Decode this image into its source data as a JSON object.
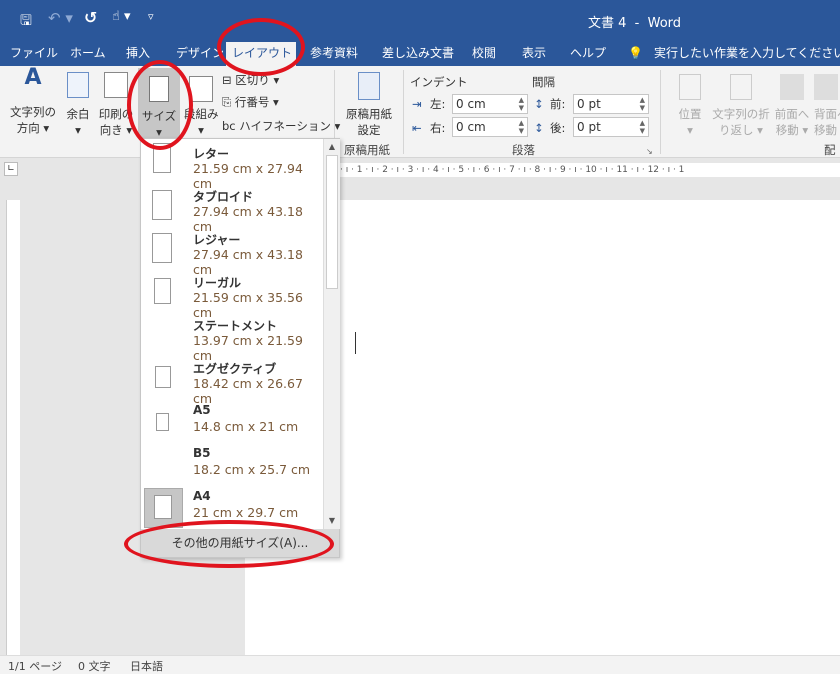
{
  "title": "文書 4  -  Word",
  "qat": [
    "save-icon",
    "undo-icon",
    "redo-icon",
    "touch-mode-icon",
    "customize-icon"
  ],
  "tabs": [
    "ファイル",
    "ホーム",
    "挿入",
    "デザイン",
    "レイアウト",
    "参考資料",
    "差し込み文書",
    "校閲",
    "表示",
    "ヘルプ"
  ],
  "active_tab": "レイアウト",
  "tell_me": "実行したい作業を入力してください",
  "ribbon": {
    "text_direction": [
      "文字列の",
      "方向 ▾"
    ],
    "margins": [
      "余白",
      "▾"
    ],
    "orientation": [
      "印刷の",
      "向き ▾"
    ],
    "size": [
      "サイズ",
      "▾"
    ],
    "columns": [
      "段組み",
      "▾"
    ],
    "breaks": "区切り ▾",
    "line_numbers": "行番号 ▾",
    "hyphenation": "ハイフネーション ▾",
    "genko": [
      "原稿用紙",
      "設定"
    ],
    "genko_group": "原稿用紙",
    "indent_label": "インデント",
    "spacing_label": "間隔",
    "left_label": "左:",
    "left_value": "0 cm",
    "right_label": "右:",
    "right_value": "0 cm",
    "before_label": "前:",
    "before_value": "0 pt",
    "after_label": "後:",
    "after_value": "0 pt",
    "paragraph_group": "段落",
    "position": [
      "位置",
      "▾"
    ],
    "wrap": [
      "文字列の折",
      "り返し ▾"
    ],
    "forward": [
      "前面へ",
      "移動 ▾"
    ],
    "backward": [
      "背面へ",
      "移動 ▾"
    ],
    "arrange_group": "配置"
  },
  "ruler": "· ı · 1 · ı · 2 · ı · 3 · ı · 4 · ı · 5 · ı · 6 · ı · 7 · ı · 8 · ı · 9 · ı · 10 · ı · 11 · ı · 12 · ı · 1",
  "sizes": [
    {
      "name": "レター",
      "size": "21.59 cm x 27.94 cm"
    },
    {
      "name": "タブロイド",
      "size": "27.94 cm x 43.18 cm"
    },
    {
      "name": "レジャー",
      "size": "27.94 cm x 43.18 cm"
    },
    {
      "name": "リーガル",
      "size": "21.59 cm x 35.56 cm"
    },
    {
      "name": "ステートメント",
      "size": "13.97 cm x 21.59 cm"
    },
    {
      "name": "エグゼクティブ",
      "size": "18.42 cm x 26.67 cm"
    },
    {
      "name": "A5",
      "size": "14.8 cm x 21 cm"
    },
    {
      "name": "B5",
      "size": "18.2 cm x 25.7 cm"
    },
    {
      "name": "A4",
      "size": "21 cm x 29.7 cm"
    }
  ],
  "selected_size": "A4",
  "more_sizes": "その他の用紙サイズ(A)...",
  "status": {
    "page": "1/1 ページ",
    "words": "0 文字",
    "language": "日本語"
  },
  "colors": {
    "brand": "#2b579a",
    "highlight": "#e0141e"
  }
}
